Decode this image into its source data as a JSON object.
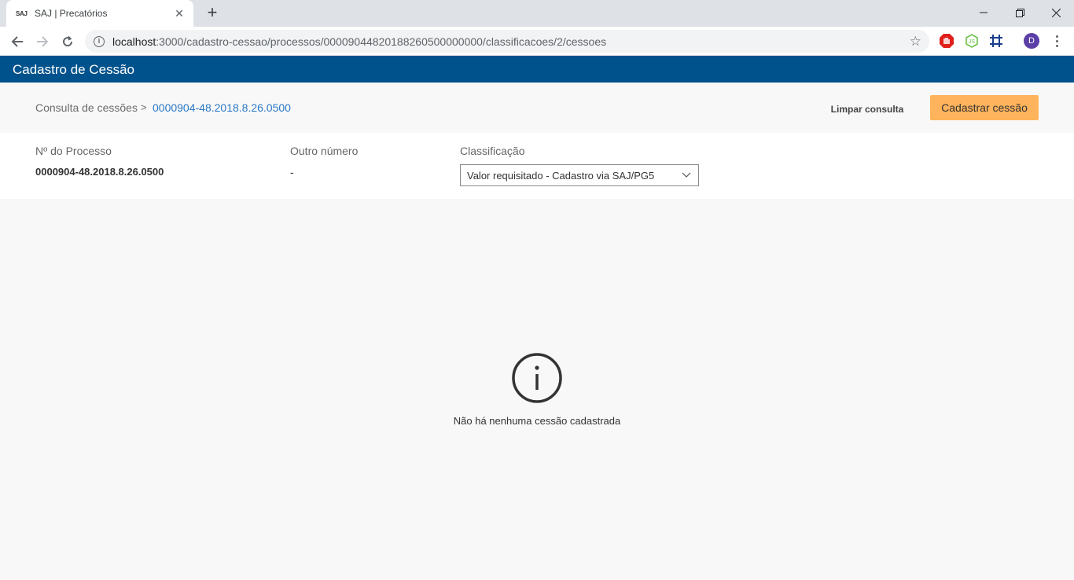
{
  "browser": {
    "tab": {
      "favicon_text": "SAJ",
      "title": "SAJ | Precatórios"
    },
    "url": {
      "host": "localhost",
      "path": ":3000/cadastro-cessao/processos/00009044820188260500000000/classificacoes/2/cessoes"
    },
    "profile_initial": "D"
  },
  "app": {
    "title": "Cadastro de Cessão",
    "brand_color": "#00528c",
    "accent_color": "#ffb35c"
  },
  "breadcrumb": {
    "root": "Consulta de cessões",
    "separator": ">",
    "current": "0000904-48.2018.8.26.0500"
  },
  "actions": {
    "limpar_label": "Limpar consulta",
    "cadastrar_label": "Cadastrar cessão"
  },
  "processo": {
    "numero_label": "Nº do Processo",
    "numero_value": "0000904-48.2018.8.26.0500",
    "outro_label": "Outro número",
    "outro_value": "-",
    "classificacao_label": "Classificação",
    "classificacao_selected": "Valor requisitado - Cadastro via SAJ/PG5"
  },
  "empty_state": {
    "icon": "info-circle-icon",
    "message": "Não há nenhuma cessão cadastrada"
  }
}
